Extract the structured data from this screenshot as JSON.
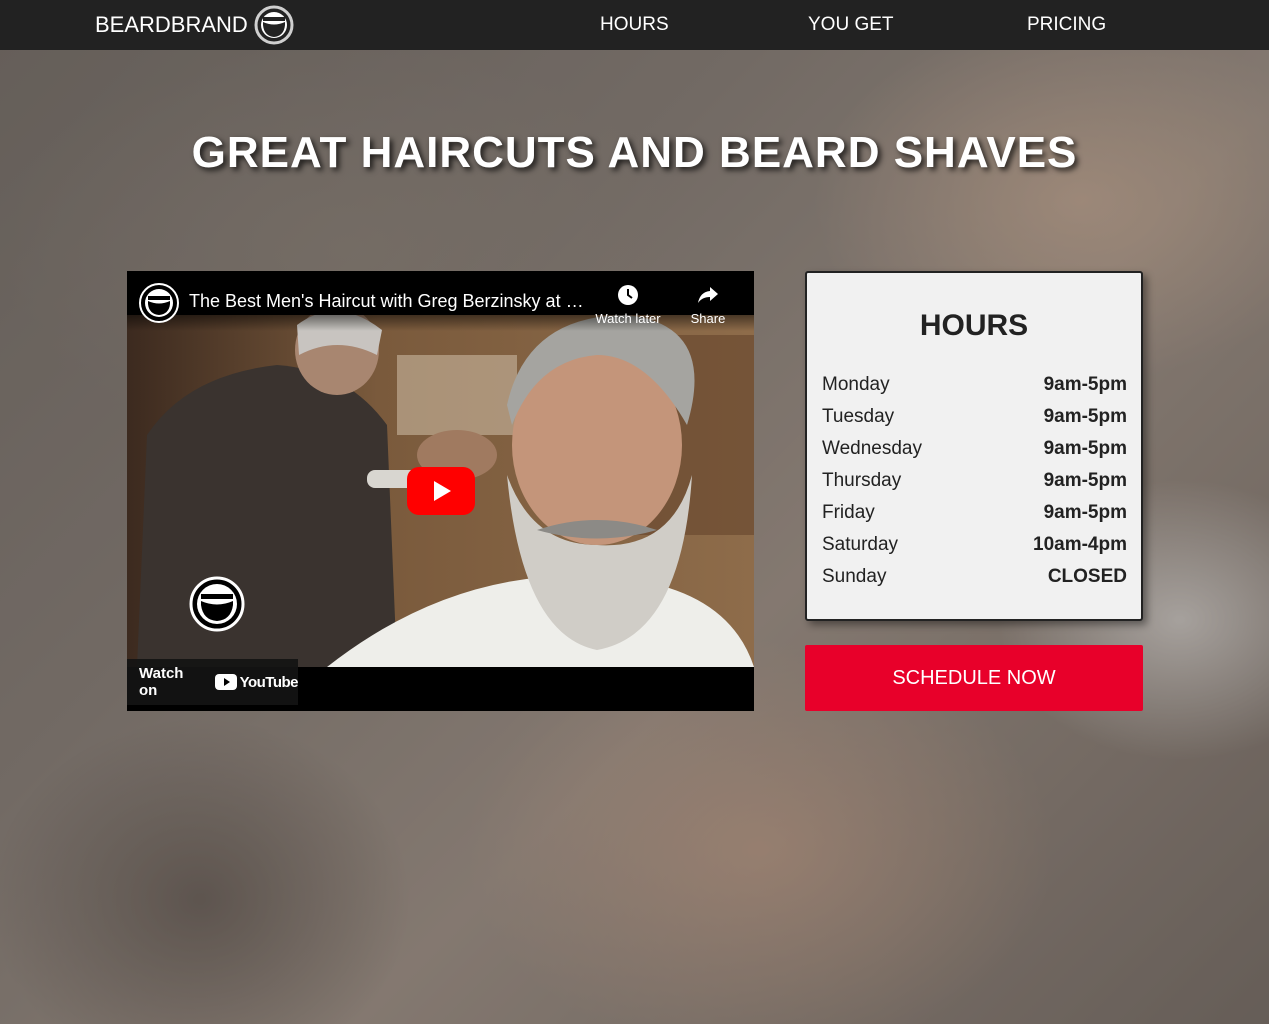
{
  "nav": {
    "brand": "BEARDBRAND",
    "links": [
      "HOURS",
      "YOU GET",
      "PRICING"
    ]
  },
  "hero": {
    "headline": "GREAT HAIRCUTS AND BEARD SHAVES"
  },
  "video": {
    "title": "The Best Men's Haircut with Greg Berzinsky at C...",
    "watch_later": "Watch later",
    "share": "Share",
    "watch_on": "Watch on",
    "youtube": "YouTube"
  },
  "hours": {
    "title": "HOURS",
    "days": [
      {
        "day": "Monday",
        "time": "9am-5pm"
      },
      {
        "day": "Tuesday",
        "time": "9am-5pm"
      },
      {
        "day": "Wednesday",
        "time": "9am-5pm"
      },
      {
        "day": "Thursday",
        "time": "9am-5pm"
      },
      {
        "day": "Friday",
        "time": "9am-5pm"
      },
      {
        "day": "Saturday",
        "time": "10am-4pm"
      },
      {
        "day": "Sunday",
        "time": "CLOSED"
      }
    ]
  },
  "cta": {
    "label": "SCHEDULE NOW"
  },
  "colors": {
    "nav_bg": "#222222",
    "accent": "#e8002a",
    "card_bg": "#f1f1f1"
  },
  "icons": [
    "beard-logo-icon",
    "clock-icon",
    "share-icon",
    "play-icon",
    "youtube-icon"
  ]
}
